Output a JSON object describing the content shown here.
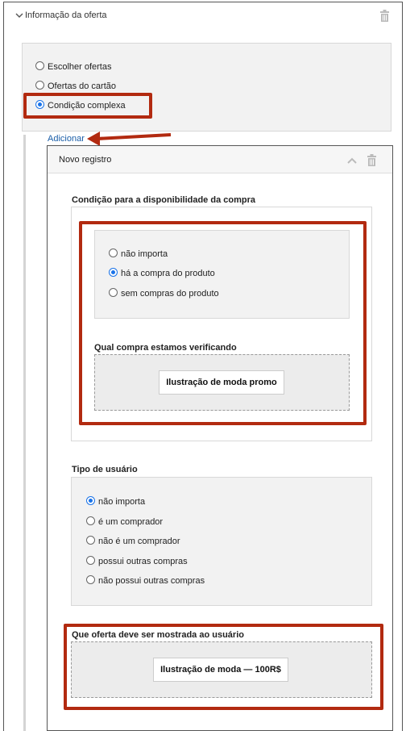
{
  "section": {
    "title": "Informação da oferta"
  },
  "offer_type": {
    "options": [
      "Escolher ofertas",
      "Ofertas do cartão",
      "Condição complexa"
    ],
    "selected": 2
  },
  "add_link": "Adicionar",
  "record": {
    "title": "Novo registro",
    "purchase_condition": {
      "title": "Condição para a disponibilidade da compra",
      "options": [
        "não importa",
        "há a compra do produto",
        "sem compras do produto"
      ],
      "selected": 1,
      "which_purchase_label": "Qual compra estamos verificando",
      "product_button": "Ilustração de moda promo"
    },
    "user_type": {
      "title": "Tipo de usuário",
      "options": [
        "não importa",
        "é um comprador",
        "não é um comprador",
        "possui outras compras",
        "não possui outras compras"
      ],
      "selected": 0
    },
    "offer_to_show": {
      "title": "Que oferta deve ser mostrada ao usuário",
      "button": "Ilustração de moda — 100R$"
    }
  },
  "colors": {
    "highlight": "#b22a10",
    "link": "#1a5ea8",
    "radio_selected": "#1a73e8"
  },
  "icons": [
    "chevron-down-icon",
    "trash-icon",
    "chevron-up-icon",
    "arrow-left-icon"
  ]
}
